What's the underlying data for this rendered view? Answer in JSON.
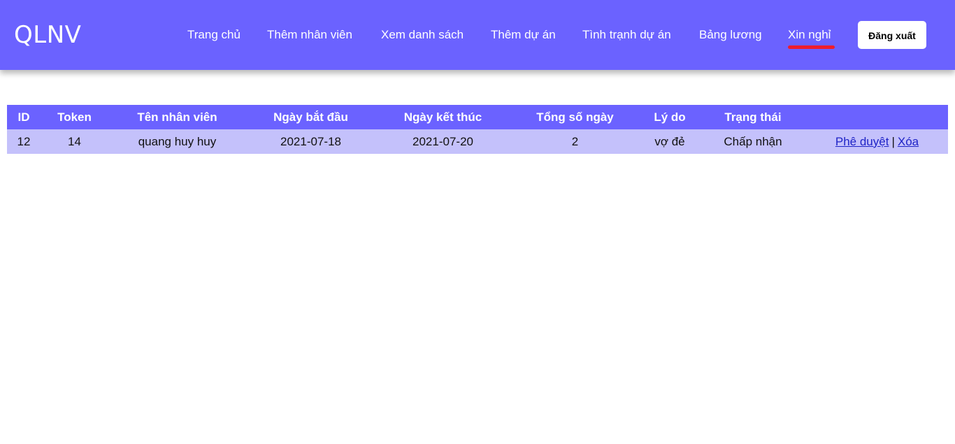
{
  "header": {
    "logo": "QLNV",
    "nav": [
      {
        "label": "Trang chủ"
      },
      {
        "label": "Thêm nhân viên"
      },
      {
        "label": "Xem danh sách"
      },
      {
        "label": "Thêm dự án"
      },
      {
        "label": "Tình trạnh dự án"
      },
      {
        "label": "Bảng lương"
      },
      {
        "label": "Xin nghỉ"
      }
    ],
    "logout_label": "Đăng xuất",
    "accent_color": "#6b62ff",
    "active_underline_color": "#ee1d2d"
  },
  "table": {
    "columns": [
      "ID",
      "Token",
      "Tên nhân viên",
      "Ngày bắt đầu",
      "Ngày kết thúc",
      "Tổng số ngày",
      "Lý do",
      "Trạng thái",
      ""
    ],
    "rows": [
      {
        "id": "12",
        "token": "14",
        "employee_name": "quang huy huy",
        "start_date": "2021-07-18",
        "end_date": "2021-07-20",
        "total_days": "2",
        "reason": "vợ đẻ",
        "status": "Chấp nhận",
        "approve_label": "Phê duyệt",
        "separator": "|",
        "delete_label": "Xóa"
      }
    ]
  }
}
